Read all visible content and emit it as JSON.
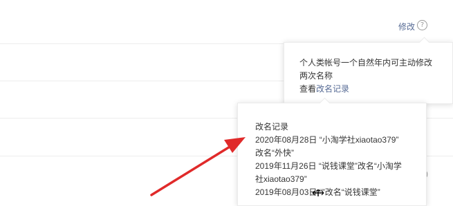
{
  "header": {
    "modify_label": "修改",
    "help_symbol": "?"
  },
  "tooltip_rule": {
    "line1": "个人类帐号一个自然年内可主动修改",
    "line2": "两次名称",
    "link_prefix": "查看",
    "link_label": "改名记录"
  },
  "rename_records": {
    "title": "改名记录",
    "lines": [
      "2020年08月28日 “小淘学社xiaotao379”",
      "改名“外快”",
      "2019年11月26日 “说钱课堂”改名“小淘学",
      "社xiaotao379”",
      "2019年08月03日 “”改名“说钱课堂”"
    ]
  },
  "side_fragment": ")",
  "colors": {
    "link": "#576b95",
    "annotation_arrow": "#e02a2a",
    "divider": "#ececec"
  }
}
